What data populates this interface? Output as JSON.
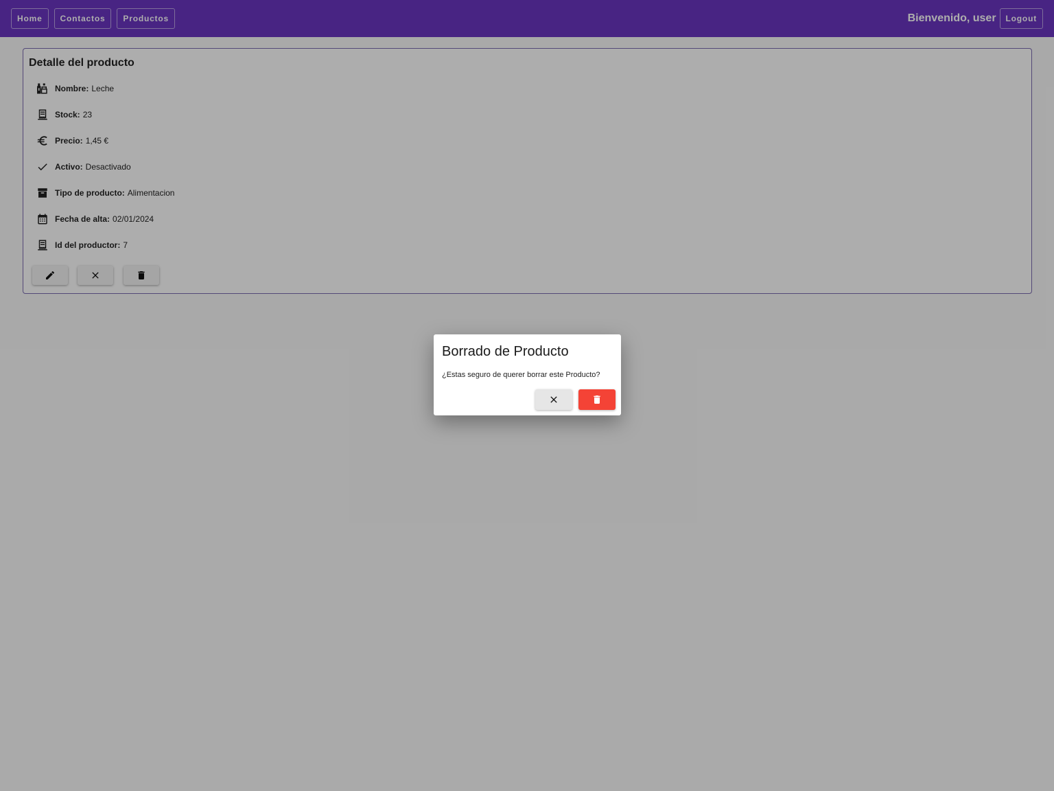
{
  "navbar": {
    "items": [
      {
        "label": "Home"
      },
      {
        "label": "Contactos"
      },
      {
        "label": "Productos"
      }
    ],
    "welcome": "Bienvenido, user",
    "logout_label": "Logout"
  },
  "card": {
    "title": "Detalle del producto",
    "fields": [
      {
        "label": "Nombre:",
        "value": "Leche",
        "icon": "wine-bottles-icon"
      },
      {
        "label": "Stock:",
        "value": "23",
        "icon": "receipt-icon"
      },
      {
        "label": "Precio:",
        "value": "1,45 €",
        "icon": "euro-icon"
      },
      {
        "label": "Activo:",
        "value": "Desactivado",
        "icon": "check-icon"
      },
      {
        "label": "Tipo de producto:",
        "value": "Alimentacion",
        "icon": "archive-icon"
      },
      {
        "label": "Fecha de alta:",
        "value": "02/01/2024",
        "icon": "calendar-icon"
      },
      {
        "label": "Id del productor:",
        "value": "7",
        "icon": "receipt-icon"
      }
    ],
    "actions": [
      "pencil-icon",
      "close-icon",
      "trash-icon"
    ]
  },
  "dialog": {
    "title": "Borrado de Producto",
    "message": "¿Estas seguro de querer borrar este Producto?",
    "cancel_icon": "close-icon",
    "confirm_icon": "trash-icon"
  },
  "colors": {
    "navbar": "#6a35c2",
    "overlay": "rgba(0,0,0,0.32)",
    "danger": "#f44336",
    "card_border": "#7b6bb0"
  }
}
